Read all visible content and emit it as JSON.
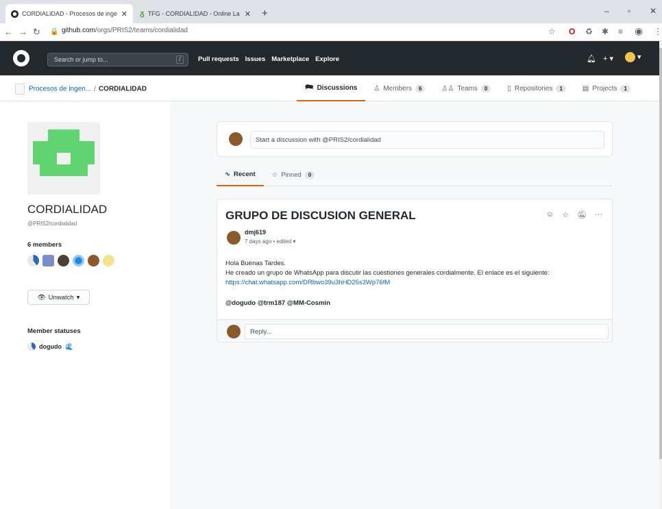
{
  "browser": {
    "tabs": [
      {
        "title": "CORDIALIDAD - Procesos de inge",
        "close": "✕"
      },
      {
        "title": "TFG - CORDIALIDAD - Online La",
        "close": "✕"
      }
    ],
    "new_tab": "+",
    "url_domain": "github.com",
    "url_path": "/orgs/PRIS2/teams/cordialidad"
  },
  "header": {
    "search_placeholder": "Search or jump to...",
    "search_key": "/",
    "nav": [
      "Pull requests",
      "Issues",
      "Marketplace",
      "Explore"
    ]
  },
  "team_bar": {
    "org": "Procesos de ingen...",
    "separator": "/",
    "team": "CORDIALIDAD",
    "tabs": [
      {
        "label": "Discussions",
        "icon": "discussion-icon",
        "count": null
      },
      {
        "label": "Members",
        "icon": "person-icon",
        "count": "6"
      },
      {
        "label": "Teams",
        "icon": "people-icon",
        "count": "0"
      },
      {
        "label": "Repositories",
        "icon": "repo-icon",
        "count": "1"
      },
      {
        "label": "Projects",
        "icon": "project-icon",
        "count": "1"
      }
    ]
  },
  "sidebar": {
    "team_name": "CORDIALIDAD",
    "team_handle": "@PRIS2/cordialidad",
    "members_title": "6 members",
    "unwatch_label": "Unwatch",
    "member_statuses_title": "Member statuses",
    "status_user": "dogudo"
  },
  "compose": {
    "placeholder": "Start a discussion with @PRIS2/cordialidad"
  },
  "subtabs": [
    {
      "label": "Recent",
      "count": null
    },
    {
      "label": "Pinned",
      "count": "0"
    }
  ],
  "post": {
    "title": "GRUPO DE DISCUSION GENERAL",
    "author": "dmj619",
    "meta": "7 days ago • edited",
    "line1": "Hola Buenas Tardes.",
    "line2": "He creado un grupo de WhatsApp para discutir las cuestiones generales cordialmente. El enlace es el siguiente:",
    "link": "https://chat.whatsapp.com/DRbwo39u3hHD25s3Wp76fM",
    "mentions": "@dogudo @trm187 @MM-Cosmin",
    "reply_placeholder": "Reply..."
  },
  "colors": {
    "header_bg": "#24292e",
    "accent_tab": "#e36209",
    "link": "#0366d6",
    "identicon_green": "#5fd471"
  }
}
